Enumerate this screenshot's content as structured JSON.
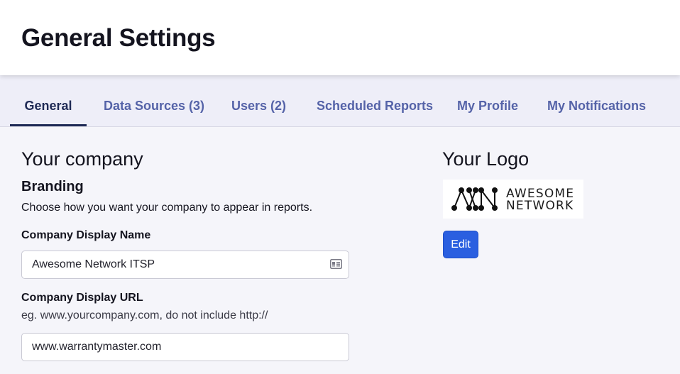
{
  "header": {
    "title": "General Settings"
  },
  "tabs": [
    {
      "label": "General",
      "active": true
    },
    {
      "label": "Data Sources (3)",
      "active": false
    },
    {
      "label": "Users (2)",
      "active": false
    },
    {
      "label": "Scheduled Reports",
      "active": false
    },
    {
      "label": "My Profile",
      "active": false
    },
    {
      "label": "My Notifications",
      "active": false
    }
  ],
  "company": {
    "section_title": "Your company",
    "branding_title": "Branding",
    "branding_desc": "Choose how you want your company to appear in reports.",
    "display_name": {
      "label": "Company Display Name",
      "value": "Awesome Network ITSP",
      "icon": "contact-card-icon"
    },
    "display_url": {
      "label": "Company Display URL",
      "hint": "eg. www.yourcompany.com, do not include http://",
      "value": "www.warrantymaster.com"
    }
  },
  "logo": {
    "section_title": "Your Logo",
    "logo_line1": "AWESOME",
    "logo_line2": "NETWORK",
    "edit_label": "Edit"
  },
  "colors": {
    "active_tab": "#1f2a55",
    "inactive_tab": "#5563a8",
    "primary_button": "#2a5fe0",
    "background": "#f5f5fa"
  }
}
